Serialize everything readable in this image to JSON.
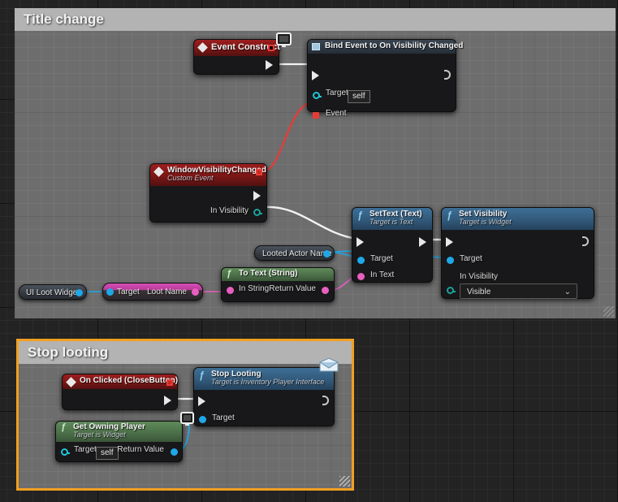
{
  "comments": [
    {
      "id": "title-change",
      "title": "Title change",
      "selected": false
    },
    {
      "id": "stop-looting",
      "title": "Stop looting",
      "selected": true,
      "border_color": "#f0a021"
    }
  ],
  "nodes": {
    "event_construct": {
      "title": "Event Construct",
      "type": "event",
      "badge": "widget-screen-icon",
      "pins": {
        "exec_out": ""
      }
    },
    "bind_event": {
      "title": "Bind Event to On Visibility Changed",
      "type": "bind",
      "icon": "bind-event-icon",
      "pins": {
        "target_label": "Target",
        "target_value": "self",
        "event_label": "Event"
      }
    },
    "window_visibility_changed": {
      "title": "WindowVisibilityChanged",
      "subtitle": "Custom Event",
      "type": "event",
      "pins": {
        "in_visibility_label": "In Visibility"
      }
    },
    "set_text": {
      "title": "SetText (Text)",
      "subtitle": "Target is Text",
      "type": "function",
      "pins": {
        "target_label": "Target",
        "in_text_label": "In Text"
      }
    },
    "set_visibility": {
      "title": "Set Visibility",
      "subtitle": "Target is Widget",
      "type": "function",
      "pins": {
        "target_label": "Target",
        "in_visibility_label": "In Visibility",
        "in_visibility_value": "Visible"
      }
    },
    "to_text_string": {
      "title": "To Text (String)",
      "type": "pure",
      "pins": {
        "in_string_label": "In String",
        "return_value_label": "Return Value"
      }
    },
    "looted_actor_name": {
      "title": "Looted Actor Name",
      "type": "variable-get"
    },
    "ui_loot_widget": {
      "title": "UI Loot Widget",
      "type": "variable-get"
    },
    "loot_name": {
      "target_label": "Target",
      "title": "Loot Name",
      "type": "variable-get"
    },
    "on_clicked_close_button": {
      "title": "On Clicked (CloseButton)",
      "type": "event"
    },
    "stop_looting_call": {
      "title": "Stop Looting",
      "subtitle": "Target is Inventory Player Interface",
      "type": "function",
      "badge": "interface-message-icon",
      "pins": {
        "target_label": "Target"
      }
    },
    "get_owning_player": {
      "title": "Get Owning Player",
      "subtitle": "Target is Widget",
      "type": "pure",
      "badge": "widget-screen-icon",
      "pins": {
        "target_label": "Target",
        "target_value": "self",
        "return_value_label": "Return Value"
      }
    }
  },
  "colors": {
    "exec_wire": "#f2f2f2",
    "delegate_wire": "#e83b36",
    "object_wire": "#1fa8e8",
    "string_wire": "#e85fc0",
    "comment_selected_border": "#f0a021",
    "comment_fill": "#6d6d6d",
    "comment_title_bar": "#b3b3b3"
  }
}
